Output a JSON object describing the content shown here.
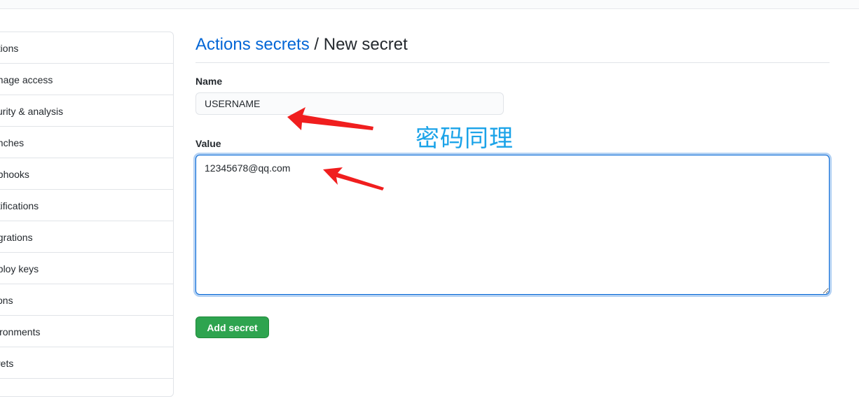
{
  "sidebar": {
    "items": [
      {
        "label": "ptions"
      },
      {
        "label": "anage access"
      },
      {
        "label": "curity & analysis"
      },
      {
        "label": "anches"
      },
      {
        "label": "ebhooks"
      },
      {
        "label": "otifications"
      },
      {
        "label": "egrations"
      },
      {
        "label": "eploy keys"
      },
      {
        "label": "tions"
      },
      {
        "label": "vironments"
      },
      {
        "label": "crets"
      }
    ]
  },
  "header": {
    "breadcrumb_link": "Actions secrets",
    "separator": "/",
    "current": "New secret"
  },
  "form": {
    "name_label": "Name",
    "name_value": "USERNAME",
    "value_label": "Value",
    "value_value": "12345678@qq.com",
    "submit_label": "Add secret"
  },
  "annotation": {
    "text": "密码同理",
    "text_color": "#1ba3e8",
    "arrow_color": "#f01e1e"
  },
  "colors": {
    "link": "#0366d6",
    "primary_button": "#2ea44f",
    "focus_border": "#0366d6"
  }
}
